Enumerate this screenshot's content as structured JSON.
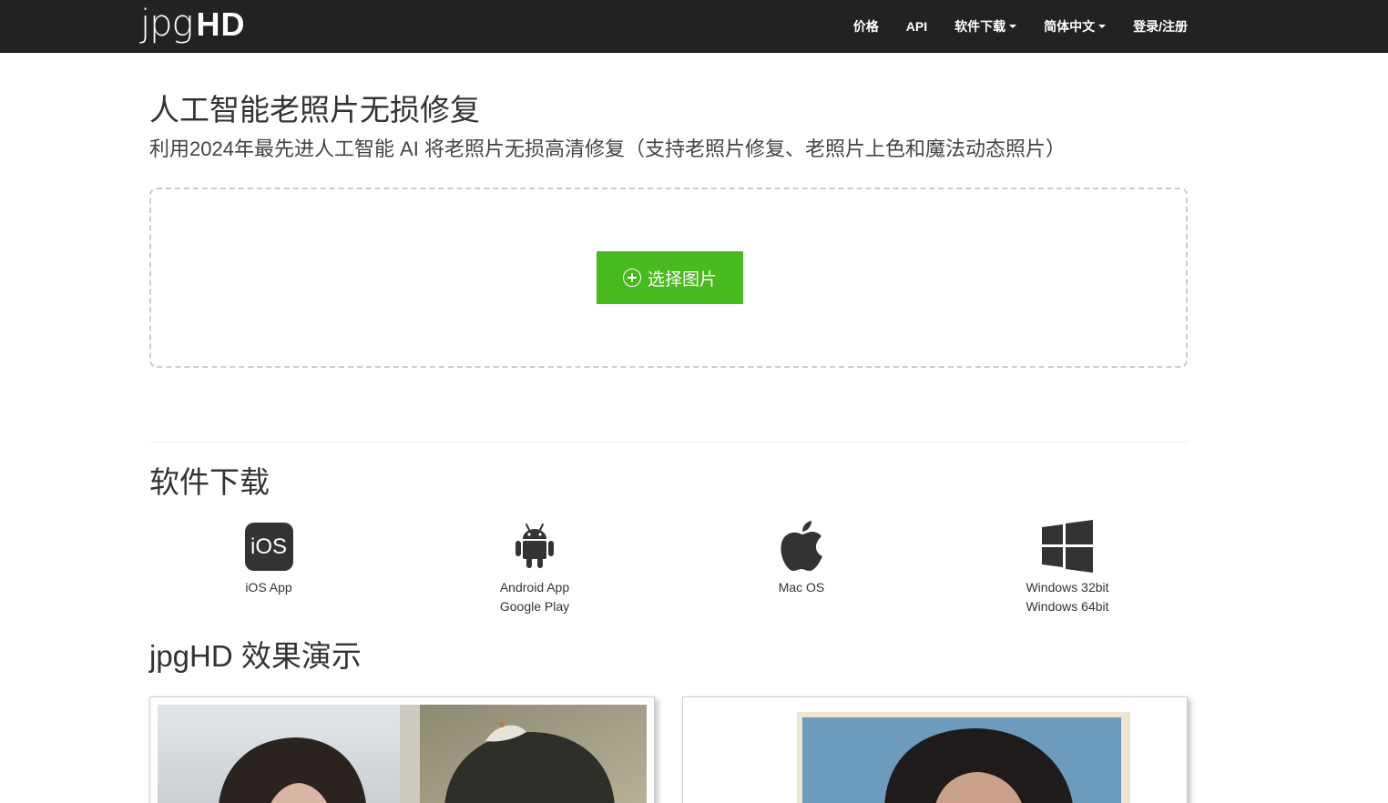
{
  "header": {
    "logo_light": "jpg",
    "logo_bold": "HD",
    "nav": [
      {
        "label": "价格"
      },
      {
        "label": "API"
      },
      {
        "label": "软件下载"
      },
      {
        "label": "简体中文"
      },
      {
        "label": "登录/注册"
      }
    ]
  },
  "hero": {
    "title": "人工智能老照片无损修复",
    "subtitle": "利用2024年最先进人工智能 AI 将老照片无损高清修复（支持老照片修复、老照片上色和魔法动态照片）",
    "button_label": "选择图片"
  },
  "downloads": {
    "title": "软件下载",
    "ios": {
      "icon_text": "iOS",
      "line1": "iOS App"
    },
    "android": {
      "line1": "Android App",
      "line2": "Google Play"
    },
    "mac": {
      "line1": "Mac OS"
    },
    "windows": {
      "line1": "Windows 32bit",
      "line2": "Windows 64bit"
    }
  },
  "demo": {
    "title": "jpgHD 效果演示"
  },
  "colors": {
    "navbar_bg": "#222222",
    "accent_green": "#48b91e"
  }
}
